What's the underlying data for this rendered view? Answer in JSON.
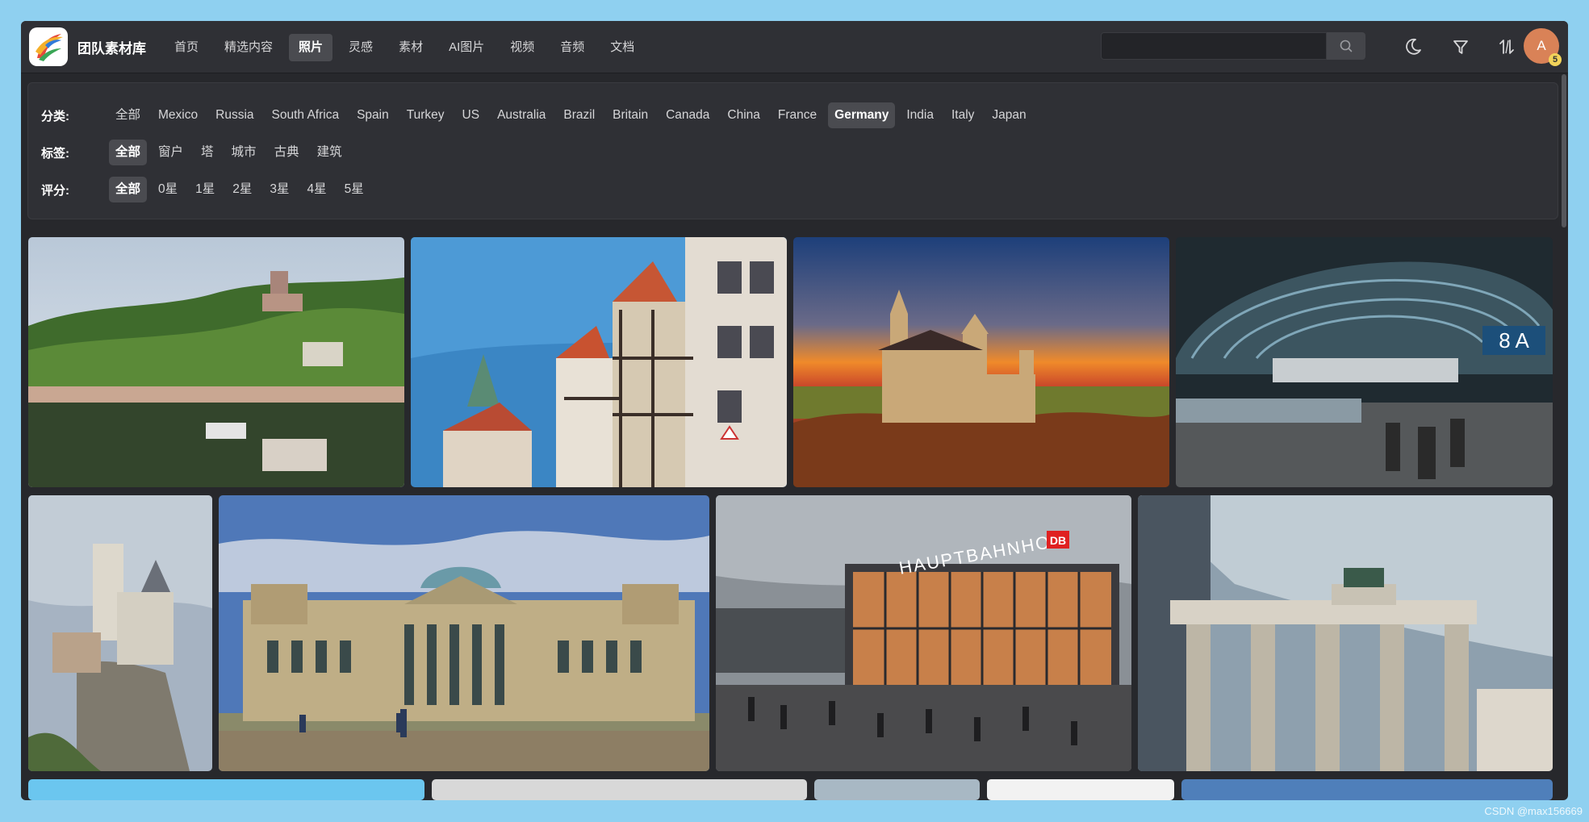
{
  "header": {
    "brand": "团队素材库",
    "nav": [
      "首页",
      "精选内容",
      "照片",
      "灵感",
      "素材",
      "AI图片",
      "视频",
      "音频",
      "文档"
    ],
    "nav_active": "照片",
    "search_value": "",
    "search_placeholder": "",
    "avatar_letter": "A",
    "badge_count": "5",
    "icons": [
      "moon-icon",
      "filter-icon",
      "sort-icon",
      "search-icon"
    ]
  },
  "filters": {
    "category": {
      "label": "分类:",
      "items": [
        "全部",
        "Mexico",
        "Russia",
        "South Africa",
        "Spain",
        "Turkey",
        "US",
        "Australia",
        "Brazil",
        "Britain",
        "Canada",
        "China",
        "France",
        "Germany",
        "India",
        "Italy",
        "Japan"
      ],
      "active": "Germany"
    },
    "tags": {
      "label": "标签:",
      "items": [
        "全部",
        "窗户",
        "塔",
        "城市",
        "古典",
        "建筑"
      ],
      "active": "全部"
    },
    "rating": {
      "label": "评分:",
      "items": [
        "全部",
        "0星",
        "1星",
        "2星",
        "3星",
        "4星",
        "5星"
      ],
      "active": "全部"
    }
  },
  "gallery": [
    {
      "name": "photo-cochem-castle-river"
    },
    {
      "name": "photo-half-timbered-houses"
    },
    {
      "name": "photo-neuschwanstein-sunset"
    },
    {
      "name": "photo-frankfurt-station"
    },
    {
      "name": "photo-lichtenstein-castle"
    },
    {
      "name": "photo-reichstag"
    },
    {
      "name": "photo-koln-hauptbahnhof"
    },
    {
      "name": "photo-brandenburg-gate"
    }
  ],
  "station_sign": "HAUPTBAHNHOF",
  "platform_sign": "8 A",
  "db_logo": "DB",
  "watermark": "CSDN @max156669"
}
